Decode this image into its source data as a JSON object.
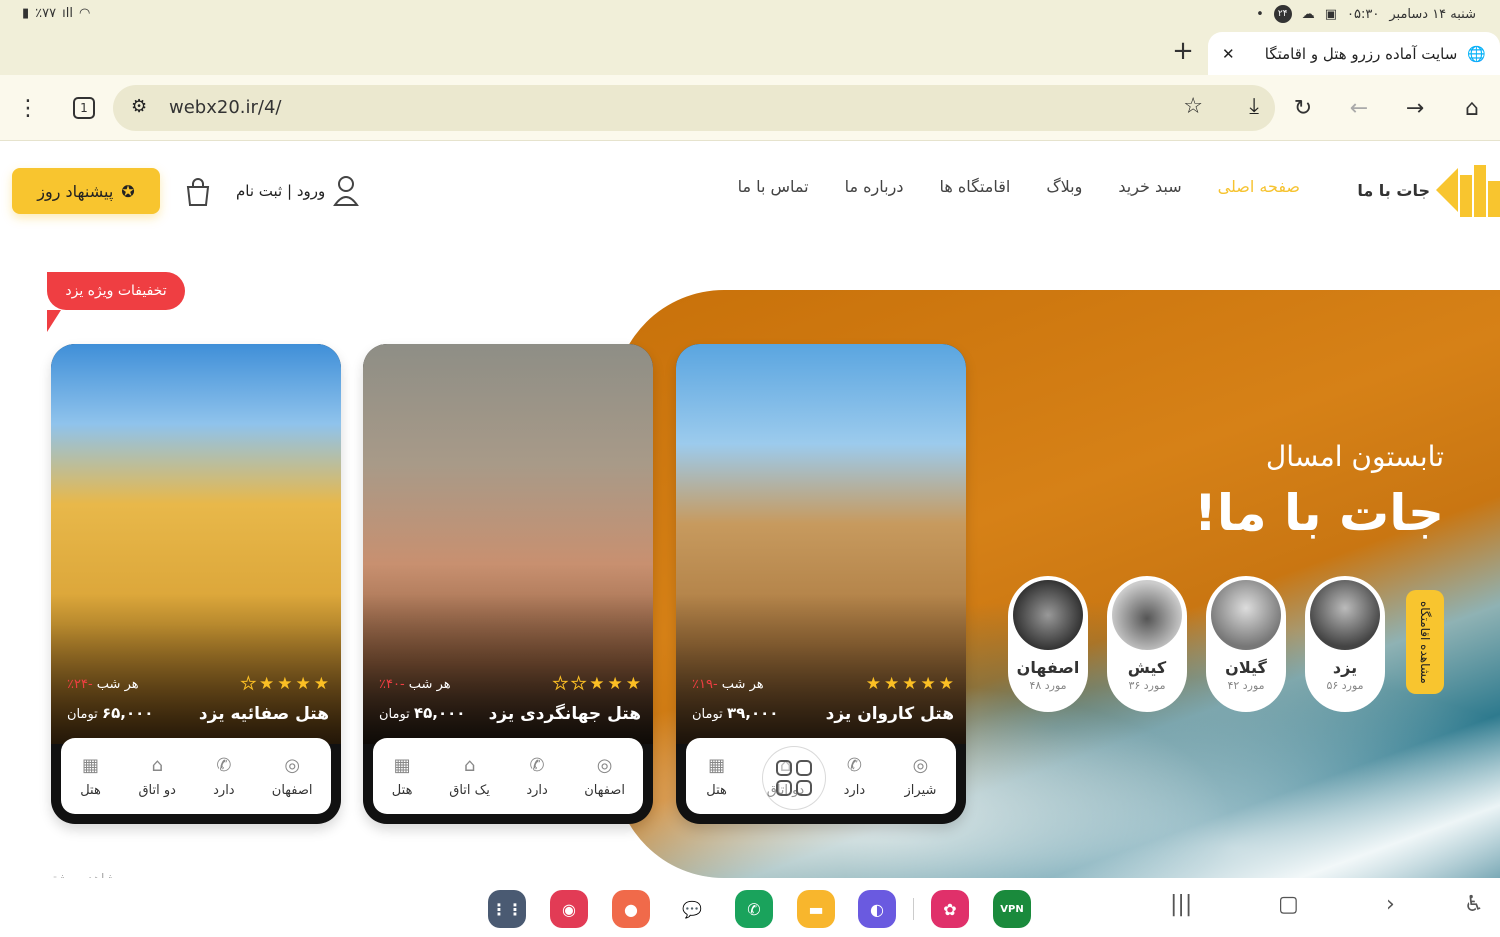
{
  "status_bar": {
    "time": "۰۵:۳۰",
    "date": "شنبه ۱۴ دسامبر",
    "battery": "٪۷۷",
    "notification_badge": "۲۴"
  },
  "browser": {
    "tab_title": "سایت آماده رزرو هتل و اقامتگا",
    "url": "webx20.ir/4/",
    "tab_count": "1"
  },
  "site": {
    "logo_text": "جات با ما",
    "nav": [
      "صفحه اصلی",
      "سبد خرید",
      "وبلاگ",
      "اقامتگاه ها",
      "درباره ما",
      "تماس با ما"
    ],
    "login_label": "ورود | ثبت نام",
    "offer_button": "پیشنهاد روز"
  },
  "hero": {
    "subtitle": "تابستون امسال",
    "title": "جات با ما!",
    "view_stays_label": "مشاهده اقامتگاه",
    "cities": [
      {
        "name": "یزد",
        "count": "۵۶ مورد"
      },
      {
        "name": "گیلان",
        "count": "۴۲ مورد"
      },
      {
        "name": "کیش",
        "count": "۳۶ مورد"
      },
      {
        "name": "اصفهان",
        "count": "۴۸ مورد"
      }
    ]
  },
  "special_badge": "تخفیفات ویژه یزد",
  "hotels": [
    {
      "name": "هتل کاروان یزد",
      "stars": 5,
      "per_night": "هر شب",
      "discount": "-۱۹٪",
      "price": "۳۹,۰۰۰",
      "currency": "تومان",
      "features": [
        "شیراز",
        "دارد",
        "دو اتاق",
        "هتل"
      ]
    },
    {
      "name": "هتل جهانگردی یزد",
      "stars": 3,
      "per_night": "هر شب",
      "discount": "-۴۰٪",
      "price": "۴۵,۰۰۰",
      "currency": "تومان",
      "features": [
        "اصفهان",
        "دارد",
        "یک اتاق",
        "هتل"
      ]
    },
    {
      "name": "هتل صفائیه یزد",
      "stars": 4,
      "per_night": "هر شب",
      "discount": "-۲۴٪",
      "price": "۶۵,۰۰۰",
      "currency": "تومان",
      "features": [
        "اصفهان",
        "دارد",
        "دو اتاق",
        "هتل"
      ]
    }
  ],
  "more_link": "مشاهده بیشتر",
  "dock_apps": [
    "apps-grid",
    "screen-recorder",
    "contacts",
    "messages",
    "phone",
    "files",
    "browser",
    "flower",
    "vpn"
  ],
  "dock_vpn_label": "VPN",
  "colors": {
    "brand_yellow": "#f8c52f",
    "accent_red": "#ef3e42",
    "hero_orange": "#d68117"
  }
}
